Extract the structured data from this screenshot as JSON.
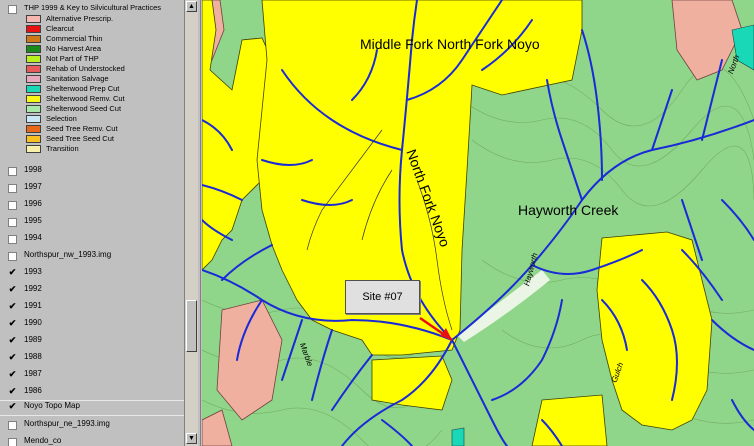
{
  "toc": {
    "active_layer": {
      "label": "THP 1999 & Key to Silvicultural Practices",
      "checked": false
    },
    "legend": [
      {
        "label": "Alternative Prescrip.",
        "color": "#f4b8b0"
      },
      {
        "label": "Clearcut",
        "color": "#e81010"
      },
      {
        "label": "Commercial Thin",
        "color": "#d07818"
      },
      {
        "label": "No Harvest Area",
        "color": "#1a8a1a"
      },
      {
        "label": "Not Part of THP",
        "color": "#b8f020"
      },
      {
        "label": "Rehab of Understocked",
        "color": "#e85a5a"
      },
      {
        "label": "Sanitation Salvage",
        "color": "#e8a8c0"
      },
      {
        "label": "Shelterwood Prep Cut",
        "color": "#18d8b8"
      },
      {
        "label": "Shelterwood Remv. Cut",
        "color": "#f8f818"
      },
      {
        "label": "Shelterwood Seed Cut",
        "color": "#a8e8a8"
      },
      {
        "label": "Selection",
        "color": "#c8e8f8"
      },
      {
        "label": "Seed Tree Remv. Cut",
        "color": "#e86818"
      },
      {
        "label": "Seed Tree Seed Cut",
        "color": "#f8c020"
      },
      {
        "label": "Transition",
        "color": "#f8f0a8"
      }
    ],
    "layers": [
      {
        "label": "1998",
        "checked": false
      },
      {
        "label": "1997",
        "checked": false
      },
      {
        "label": "1996",
        "checked": false
      },
      {
        "label": "1995",
        "checked": false
      },
      {
        "label": "1994",
        "checked": false
      },
      {
        "label": "Northspur_nw_1993.img",
        "checked": false
      },
      {
        "label": "1993",
        "checked": true
      },
      {
        "label": "1992",
        "checked": true
      },
      {
        "label": "1991",
        "checked": true
      },
      {
        "label": "1990",
        "checked": true
      },
      {
        "label": "1989",
        "checked": true
      },
      {
        "label": "1988",
        "checked": true
      },
      {
        "label": "1987",
        "checked": true
      },
      {
        "label": "1986",
        "checked": true
      },
      {
        "label": "Noyo Topo Map",
        "checked": true
      },
      {
        "label": "Northspur_ne_1993.img",
        "checked": false
      },
      {
        "label": "Mendo_co",
        "checked": false
      }
    ],
    "check_glyph": "✔"
  },
  "map": {
    "labels": {
      "middle_fork": "Middle Fork North Fork Noyo",
      "north_fork": "North Fork Noyo",
      "hayworth": "Hayworth Creek",
      "small_north": "North",
      "small_hayworth": "Hayworth",
      "small_gulch": "Gulch",
      "small_marble": "Marble"
    },
    "callout": "Site #07",
    "colors": {
      "shelterwood": "#ffff00",
      "forest": "#8fd68a",
      "stream": "#1a2ad8",
      "pink": "#f0b0a0",
      "prep": "#18d8b8",
      "contour": "#5a8a3a"
    }
  }
}
